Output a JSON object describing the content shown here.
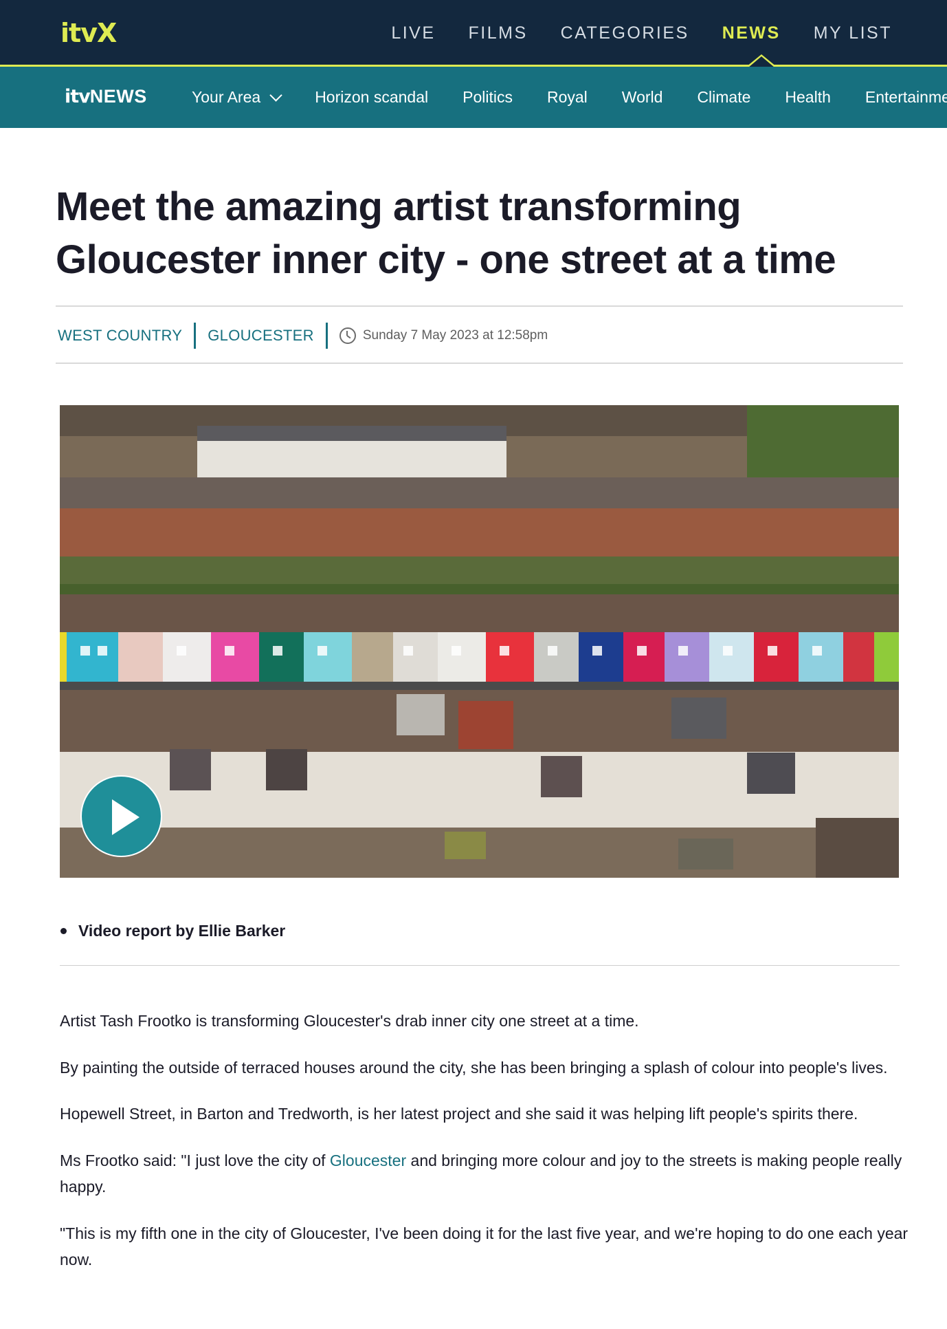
{
  "brand": {
    "logo": "itvX",
    "accent_color": "#deeb52",
    "nav_bg": "#13283e"
  },
  "top_nav": [
    {
      "label": "LIVE",
      "active": false
    },
    {
      "label": "FILMS",
      "active": false
    },
    {
      "label": "CATEGORIES",
      "active": false
    },
    {
      "label": "NEWS",
      "active": true
    },
    {
      "label": "MY LIST",
      "active": false
    }
  ],
  "news_bar": {
    "logo_itv": "itv",
    "logo_news": "NEWS",
    "bg_color": "#17707f",
    "items": [
      "Your Area",
      "Horizon scandal",
      "Politics",
      "Royal",
      "World",
      "Climate",
      "Health",
      "Entertainment"
    ]
  },
  "article": {
    "headline": "Meet the amazing artist transforming Gloucester inner city - one street at a time",
    "tags": [
      "WEST COUNTRY",
      "GLOUCESTER"
    ],
    "published": "Sunday 7 May 2023 at 12:58pm",
    "video_icon": "play-icon",
    "caption": "Video report by Ellie Barker",
    "paragraphs": [
      "Artist Tash Frootko is transforming Gloucester's drab inner city one street at a time.",
      "By painting the outside of terraced houses around the city, she has been bringing a splash of colour into people's lives.",
      "Hopewell Street, in Barton and Tredworth, is her latest project and she said it was helping lift people's spirits there."
    ],
    "quote_prefix": "Ms Frootko said: \"I just love the city of ",
    "quote_link": "Gloucester",
    "quote_suffix": " and bringing more colour and joy to the streets is making people really happy.",
    "last_paragraph": "\"This is my fifth one in the city of Gloucester, I've been doing it for the last five year, and we're hoping to do one each year now."
  }
}
